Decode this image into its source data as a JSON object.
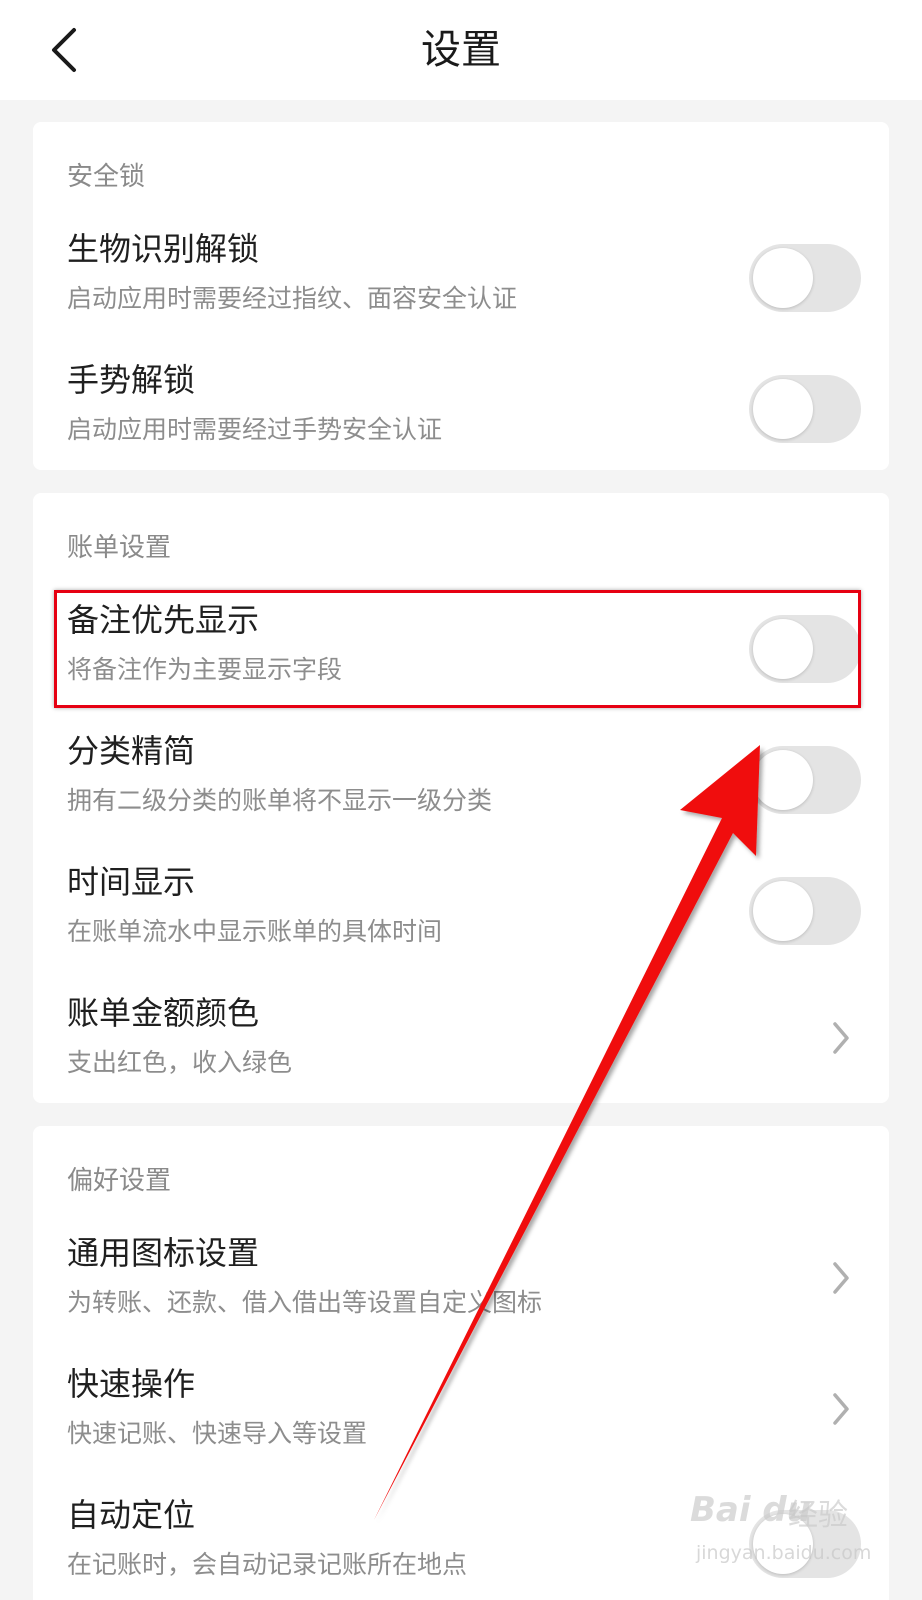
{
  "header": {
    "title": "设置",
    "back_icon": "chevron-left-icon"
  },
  "sections": [
    {
      "title": "安全锁",
      "items": [
        {
          "title": "生物识别解锁",
          "subtitle": "启动应用时需要经过指纹、面容安全认证",
          "control": "toggle",
          "on": false
        },
        {
          "title": "手势解锁",
          "subtitle": "启动应用时需要经过手势安全认证",
          "control": "toggle",
          "on": false
        }
      ]
    },
    {
      "title": "账单设置",
      "items": [
        {
          "title": "备注优先显示",
          "subtitle": "将备注作为主要显示字段",
          "control": "toggle",
          "on": false
        },
        {
          "title": "分类精简",
          "subtitle": "拥有二级分类的账单将不显示一级分类",
          "control": "toggle",
          "on": false
        },
        {
          "title": "时间显示",
          "subtitle": "在账单流水中显示账单的具体时间",
          "control": "toggle",
          "on": false
        },
        {
          "title": "账单金额颜色",
          "subtitle": "支出红色，收入绿色",
          "control": "chevron"
        }
      ]
    },
    {
      "title": "偏好设置",
      "items": [
        {
          "title": "通用图标设置",
          "subtitle": "为转账、还款、借入借出等设置自定义图标",
          "control": "chevron"
        },
        {
          "title": "快速操作",
          "subtitle": "快速记账、快速导入等设置",
          "control": "chevron"
        },
        {
          "title": "自动定位",
          "subtitle": "在记账时，会自动记录记账所在地点",
          "control": "toggle",
          "on": false
        }
      ]
    }
  ],
  "annotation": {
    "highlight_color": "#e60012",
    "arrow_color": "#f01010"
  },
  "watermark": {
    "brand": "Bai du",
    "label": "经验",
    "url": "jingyan.baidu.com"
  },
  "colors": {
    "toggle_off": "#e4e4e4",
    "background": "#f4f4f4",
    "card": "#ffffff"
  }
}
